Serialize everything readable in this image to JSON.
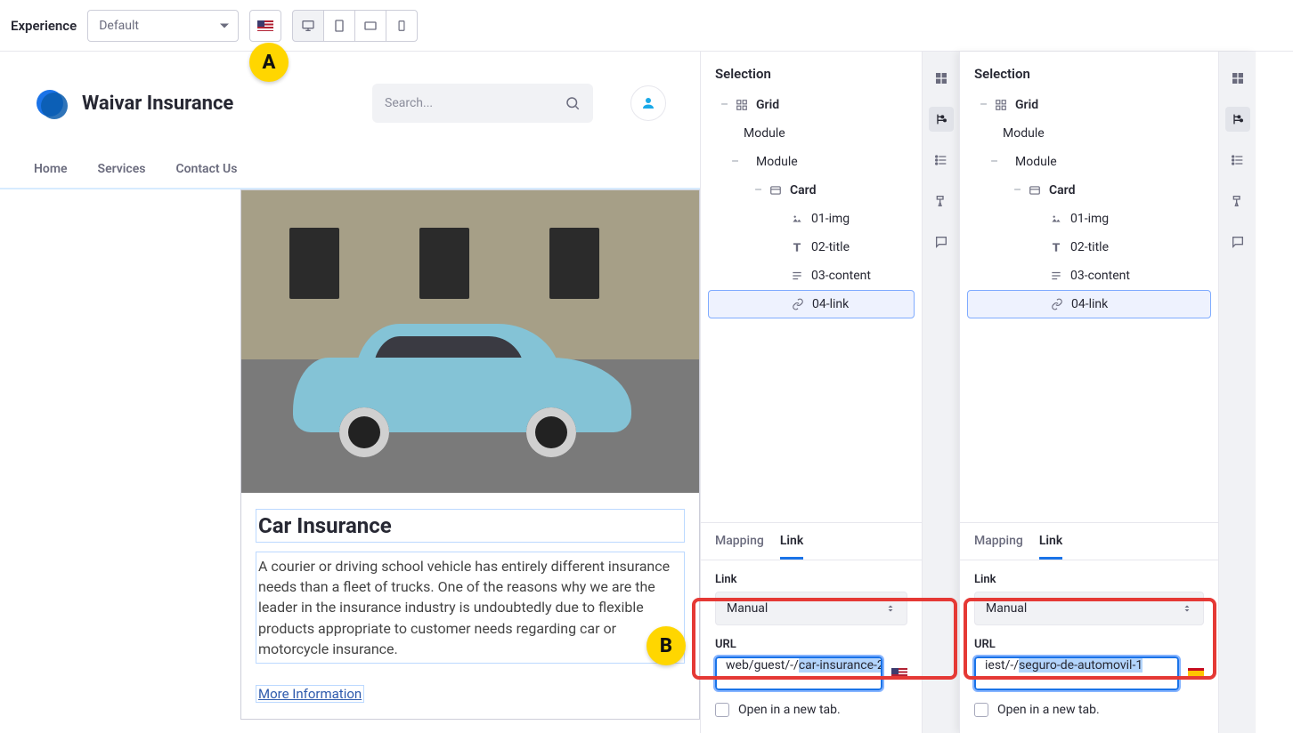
{
  "topbar": {
    "experience_label": "Experience",
    "experience_value": "Default"
  },
  "brand": {
    "name": "Waivar Insurance",
    "search_placeholder": "Search..."
  },
  "nav": {
    "home": "Home",
    "services": "Services",
    "contact": "Contact Us"
  },
  "card": {
    "title": "Car Insurance",
    "text": "A courier or driving school vehicle has entirely different insurance needs than a fleet of trucks. One of the reasons why we are the leader in the insurance industry is undoubtedly due to flexible products appropriate to customer needs regarding car or motorcycle insurance.",
    "link": "More Information"
  },
  "panel1": {
    "title": "Selection",
    "tree": {
      "grid": "Grid",
      "module1": "Module",
      "module2": "Module",
      "card": "Card",
      "img": "01-img",
      "title": "02-title",
      "content": "03-content",
      "link": "04-link"
    },
    "tabs": {
      "mapping": "Mapping",
      "link": "Link"
    },
    "link_label": "Link",
    "link_value": "Manual",
    "url_label": "URL",
    "url_prefix": "web/guest/-/",
    "url_sel": "car-insurance-2",
    "open_tab": "Open in a new tab."
  },
  "panel2": {
    "title": "Selection",
    "tree": {
      "grid": "Grid",
      "module1": "Module",
      "module2": "Module",
      "card": "Card",
      "img": "01-img",
      "title": "02-title",
      "content": "03-content",
      "link": "04-link"
    },
    "tabs": {
      "mapping": "Mapping",
      "link": "Link"
    },
    "link_label": "Link",
    "link_value": "Manual",
    "url_label": "URL",
    "url_prefix": "iest/-/",
    "url_sel": "seguro-de-automovil-1",
    "open_tab": "Open in a new tab."
  },
  "annotations": {
    "A": "A",
    "B": "B"
  }
}
